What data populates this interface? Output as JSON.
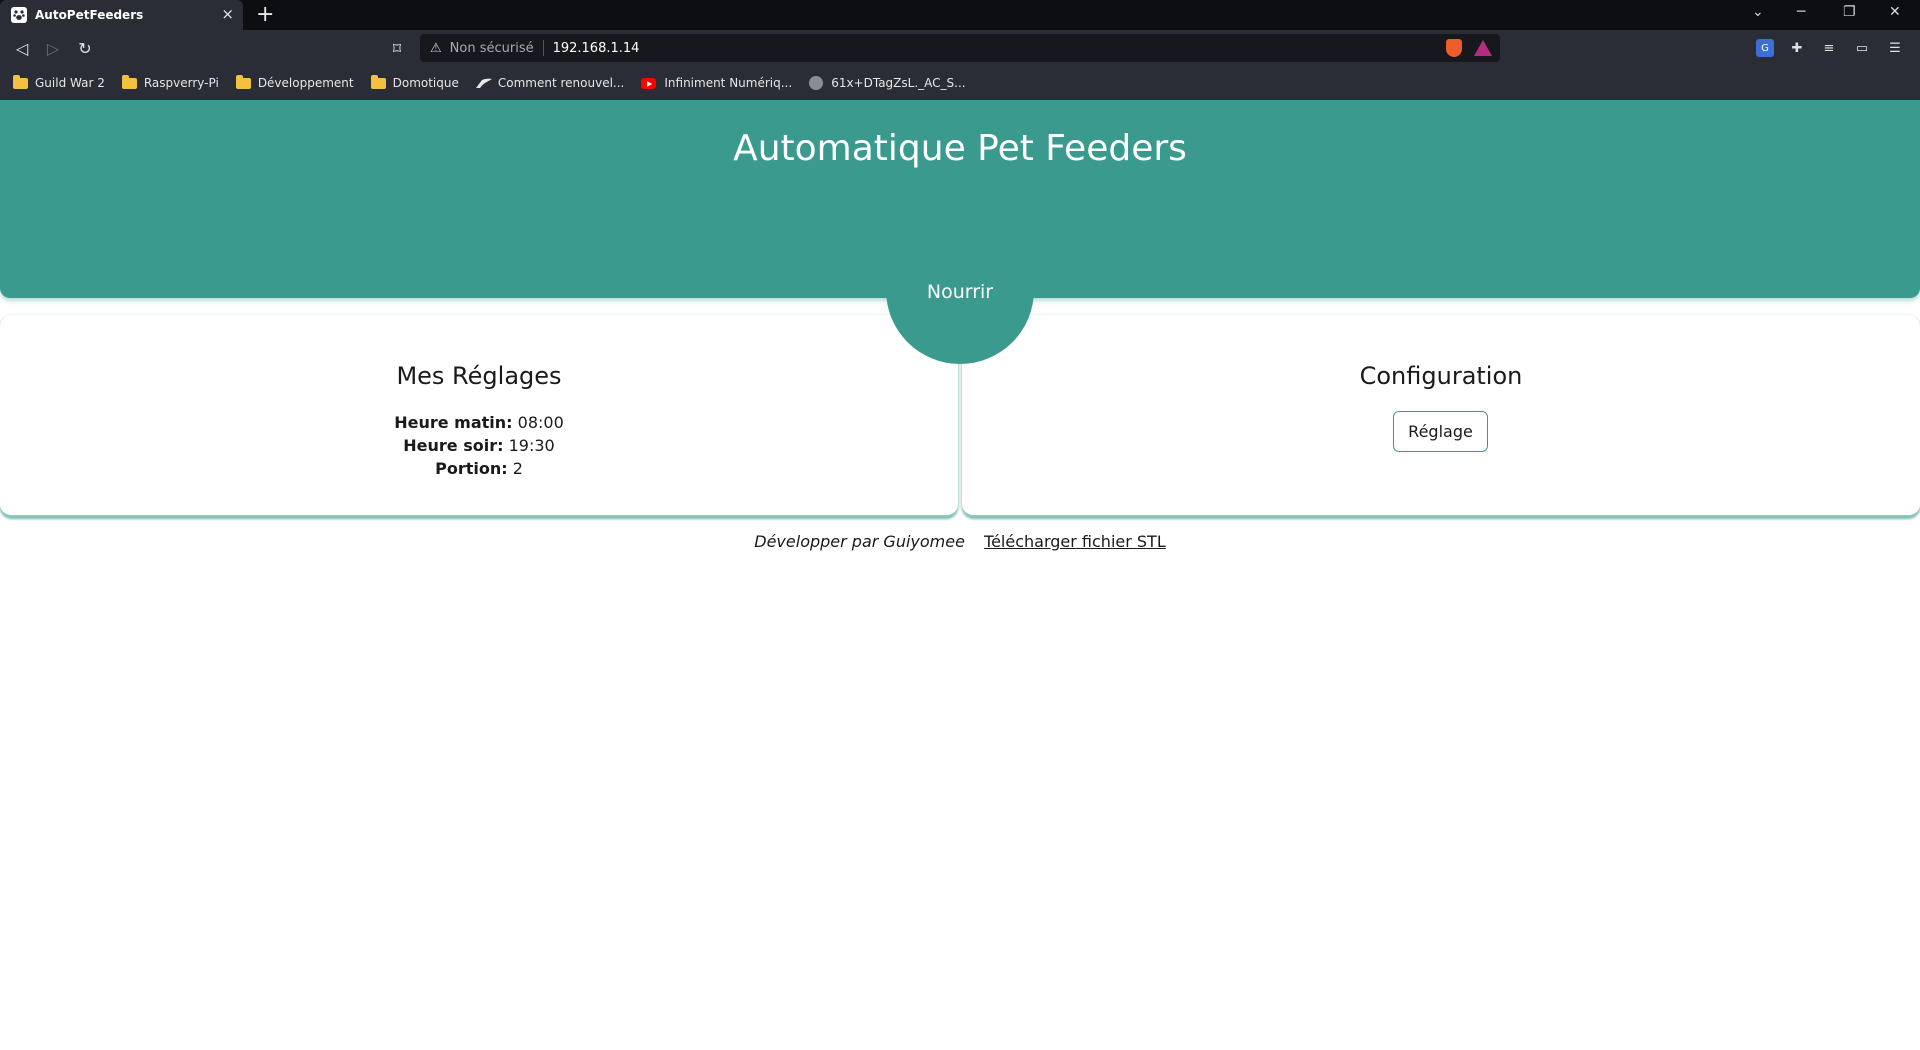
{
  "browser": {
    "tab_title": "AutoPetFeeders",
    "tab_close": "×",
    "new_tab": "+",
    "security_label": "Non sécurisé",
    "url": "192.168.1.14",
    "bookmarks": [
      {
        "label": "Guild War 2",
        "icon": "folder-icon"
      },
      {
        "label": "Raspverry-Pi",
        "icon": "folder-icon"
      },
      {
        "label": "Développement",
        "icon": "folder-icon"
      },
      {
        "label": "Domotique",
        "icon": "folder-icon"
      },
      {
        "label": "Comment renouvel...",
        "icon": "wing-icon"
      },
      {
        "label": "Infiniment Numériq...",
        "icon": "youtube-icon"
      },
      {
        "label": "61x+DTagZsL._AC_S...",
        "icon": "globe-icon"
      }
    ],
    "colors": {
      "tabbar": "#0d0e12",
      "toolbar": "#2a2d36",
      "urlbar": "#17181d"
    }
  },
  "header": {
    "title": "Automatique Pet Feeders",
    "feed_button": "Nourrir",
    "color": "#3a9a8e"
  },
  "settings_card": {
    "title": "Mes Réglages",
    "morning_label": "Heure matin:",
    "morning_value": "08:00",
    "evening_label": "Heure soir:",
    "evening_value": "19:30",
    "portion_label": "Portion:",
    "portion_value": "2"
  },
  "config_card": {
    "title": "Configuration",
    "button": "Réglage"
  },
  "footer": {
    "author": "Développer par Guiyomee",
    "download_link": "Télécharger fichier STL"
  }
}
